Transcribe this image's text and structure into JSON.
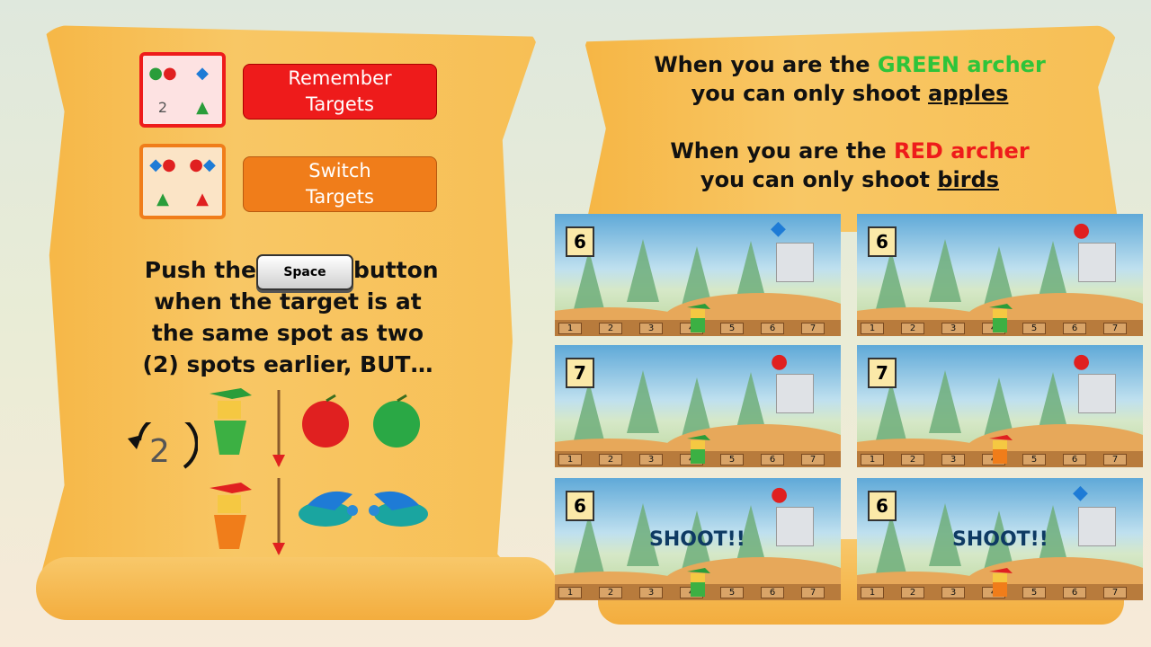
{
  "rules": {
    "remember": {
      "label": "Remember\nTargets",
      "color": "#ee1b1b"
    },
    "switch": {
      "label": "Switch\nTargets",
      "color": "#f07d1a"
    },
    "icon_glyph": "2"
  },
  "instructions": {
    "line1a": "Push the",
    "space_key": "Space",
    "line1b": "button",
    "line2": "when the target is at",
    "line3": "the same spot as two",
    "line4": "(2) spots earlier, BUT…",
    "back_count": "2"
  },
  "statement": {
    "green_a": "When you are the ",
    "green_word": "GREEN archer",
    "green_b": "you can only shoot ",
    "green_target": "apples",
    "red_a": "When you are the ",
    "red_word": "RED archer",
    "red_b": "you can only shoot ",
    "red_target": "birds"
  },
  "panels": [
    {
      "number": "6",
      "target": "bird",
      "archer": "green",
      "shoot": ""
    },
    {
      "number": "6",
      "target": "apple",
      "archer": "green",
      "shoot": ""
    },
    {
      "number": "7",
      "target": "apple",
      "archer": "green",
      "shoot": ""
    },
    {
      "number": "7",
      "target": "apple",
      "archer": "red",
      "shoot": ""
    },
    {
      "number": "6",
      "target": "apple",
      "archer": "green",
      "shoot": "SHOOT!!"
    },
    {
      "number": "6",
      "target": "bird",
      "archer": "red",
      "shoot": "SHOOT!!"
    }
  ],
  "slots": [
    "1",
    "2",
    "3",
    "4",
    "5",
    "6",
    "7"
  ]
}
